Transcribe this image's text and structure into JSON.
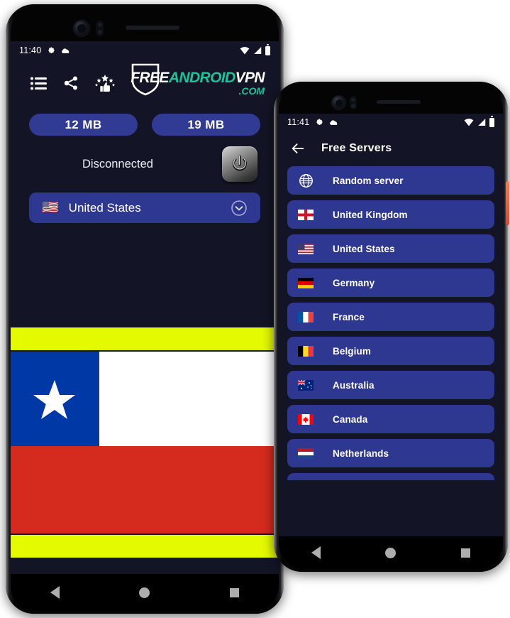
{
  "app": {
    "logo": {
      "part_free": "FREE",
      "part_android": "ANDROID",
      "part_vpn": "VPN",
      "part_com": ".COM",
      "color_accent": "#18c49a",
      "color_white": "#ffffff"
    },
    "colors": {
      "background": "#131426",
      "card": "#2f3891",
      "pill": "#323b94",
      "accent_yellow": "#e4fa00",
      "text": "#ffffff"
    }
  },
  "phone1": {
    "statusbar": {
      "time": "11:40",
      "icons_left": [
        "gear-icon",
        "cloud-icon"
      ],
      "icons_right": [
        "wifi-icon",
        "signal-icon",
        "battery-icon"
      ]
    },
    "toolbar": {
      "icons": [
        {
          "name": "list-icon",
          "label": "Menu"
        },
        {
          "name": "share-icon",
          "label": "Share"
        },
        {
          "name": "rate-icon",
          "label": "Rate us"
        }
      ]
    },
    "usage": {
      "download_label": "12 MB",
      "upload_label": "19 MB"
    },
    "connection": {
      "status": "Disconnected",
      "power_button_label": "Connect"
    },
    "country_selector": {
      "flag": "🇺🇸",
      "name": "United States",
      "chevron": "chevron-down-icon"
    },
    "banner": {
      "type": "flag-banner",
      "flag_country": "Chile",
      "top_band_color": "#e4fa00",
      "bottom_band_color": "#e4fa00",
      "flag_colors": [
        "#0039a6",
        "#ffffff",
        "#d52b1e"
      ]
    },
    "navbar": [
      "back-nav-icon",
      "home-nav-icon",
      "recents-nav-icon"
    ]
  },
  "phone2": {
    "statusbar": {
      "time": "11:41",
      "icons_left": [
        "gear-icon",
        "cloud-icon"
      ],
      "icons_right": [
        "wifi-icon",
        "signal-icon",
        "battery-icon"
      ]
    },
    "header": {
      "back": "back-arrow-icon",
      "title": "Free Servers"
    },
    "servers": [
      {
        "flag": "globe",
        "name": "Random server"
      },
      {
        "flag": "🏴󠁧󠁢󠁥󠁮󠁧󠁿",
        "name": "United Kingdom"
      },
      {
        "flag": "🇺🇸",
        "name": "United States"
      },
      {
        "flag": "🇩🇪",
        "name": "Germany"
      },
      {
        "flag": "🇫🇷",
        "name": "France"
      },
      {
        "flag": "🇧🇪",
        "name": "Belgium"
      },
      {
        "flag": "🇦🇺",
        "name": "Australia"
      },
      {
        "flag": "🇨🇦",
        "name": "Canada"
      },
      {
        "flag": "🇳🇱",
        "name": "Netherlands"
      }
    ],
    "navbar": [
      "back-nav-icon",
      "home-nav-icon",
      "recents-nav-icon"
    ]
  }
}
